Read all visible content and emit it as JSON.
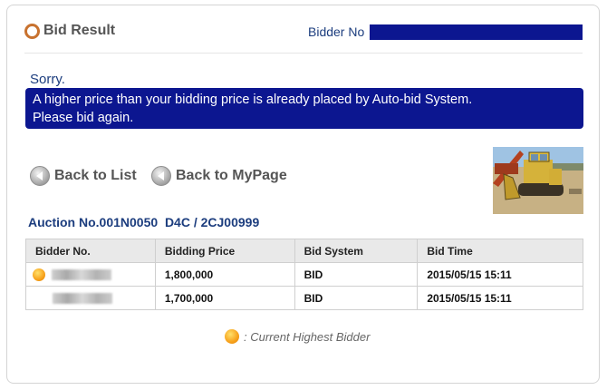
{
  "header": {
    "title": "Bid Result",
    "bidder_label": "Bidder No"
  },
  "message": {
    "sorry": "Sorry.",
    "line1": "A higher price than your bidding price is already placed by Auto-bid System.",
    "line2": "Please bid again."
  },
  "buttons": {
    "back_to_list": "Back to List",
    "back_to_mypage": "Back to MyPage"
  },
  "auction": {
    "title": "Auction No.001N0050  D4C / 2CJ00999"
  },
  "table": {
    "headers": [
      "Bidder No.",
      "Bidding Price",
      "Bid System",
      "Bid Time"
    ],
    "rows": [
      {
        "price": "1,800,000",
        "system": "BID",
        "time": "2015/05/15 15:11"
      },
      {
        "price": "1,700,000",
        "system": "BID",
        "time": "2015/05/15 15:11"
      }
    ]
  },
  "legend": {
    "text": ": Current Highest Bidder"
  },
  "colors": {
    "navy": "#0c1690",
    "text_blue": "#1c3d7e",
    "orange": "#f7a11b"
  }
}
